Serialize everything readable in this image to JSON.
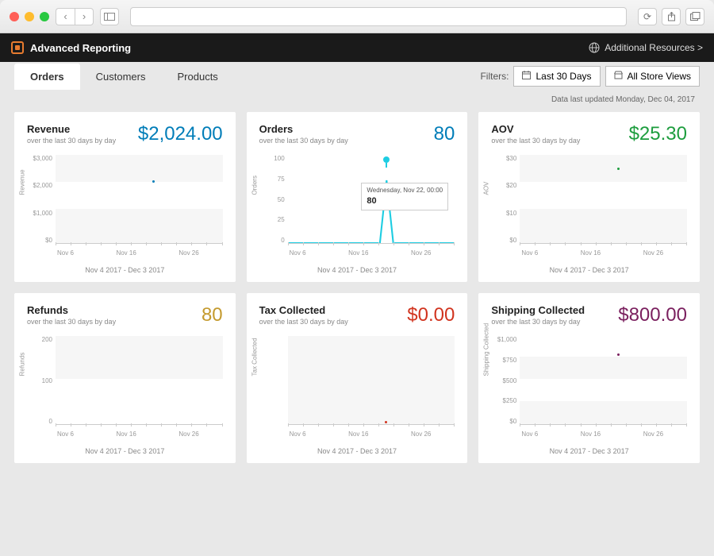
{
  "app": {
    "title": "Advanced Reporting",
    "resources": "Additional Resources >"
  },
  "tabs": {
    "orders": "Orders",
    "customers": "Customers",
    "products": "Products"
  },
  "filters": {
    "label": "Filters:",
    "period": "Last 30 Days",
    "scope": "All Store Views"
  },
  "updated": "Data last updated Monday, Dec 04, 2017",
  "common": {
    "subtitle": "over the last 30 days by day",
    "range": "Nov 4 2017 - Dec 3 2017",
    "xlabels": [
      "Nov 6",
      "",
      "Nov 16",
      "",
      "Nov 26",
      ""
    ]
  },
  "cards": {
    "revenue": {
      "title": "Revenue",
      "value": "$2,024.00",
      "yticks": [
        "$3,000",
        "$2,000",
        "$1,000",
        "$0"
      ],
      "axis": "Revenue"
    },
    "orders": {
      "title": "Orders",
      "value": "80",
      "yticks": [
        "100",
        "75",
        "50",
        "25",
        "0"
      ],
      "axis": "Orders",
      "tooltip_date": "Wednesday, Nov 22, 00:00",
      "tooltip_val": "80"
    },
    "aov": {
      "title": "AOV",
      "value": "$25.30",
      "yticks": [
        "$30",
        "$20",
        "$10",
        "$0"
      ],
      "axis": "AOV"
    },
    "refunds": {
      "title": "Refunds",
      "value": "80",
      "yticks": [
        "200",
        "100",
        "0"
      ],
      "axis": "Refunds"
    },
    "tax": {
      "title": "Tax Collected",
      "value": "$0.00",
      "yticks": [
        "",
        "",
        "",
        ""
      ],
      "axis": "Tax Collected"
    },
    "shipping": {
      "title": "Shipping Collected",
      "value": "$800.00",
      "yticks": [
        "$1,000",
        "$750",
        "$500",
        "$250",
        "$0"
      ],
      "axis": "Shipping Collected"
    }
  },
  "chart_data": [
    {
      "type": "line",
      "title": "Revenue",
      "ylabel": "Revenue",
      "ylim": [
        0,
        3000
      ],
      "x": [
        "Nov 4",
        "Nov 22",
        "Dec 3"
      ],
      "values": [
        0,
        2024,
        0
      ],
      "date_range": "Nov 4 2017 - Dec 3 2017"
    },
    {
      "type": "line",
      "title": "Orders",
      "ylabel": "Orders",
      "ylim": [
        0,
        100
      ],
      "x": [
        "Nov 4",
        "Nov 22",
        "Dec 3"
      ],
      "values": [
        0,
        80,
        0
      ],
      "date_range": "Nov 4 2017 - Dec 3 2017",
      "tooltip": {
        "label": "Wednesday, Nov 22, 00:00",
        "value": 80
      }
    },
    {
      "type": "line",
      "title": "AOV",
      "ylabel": "AOV",
      "ylim": [
        0,
        30
      ],
      "x": [
        "Nov 4",
        "Nov 22",
        "Dec 3"
      ],
      "values": [
        0,
        25.3,
        0
      ],
      "date_range": "Nov 4 2017 - Dec 3 2017"
    },
    {
      "type": "line",
      "title": "Refunds",
      "ylabel": "Refunds",
      "ylim": [
        0,
        200
      ],
      "x": [
        "Nov 4",
        "Dec 3"
      ],
      "values": [
        0,
        0
      ],
      "date_range": "Nov 4 2017 - Dec 3 2017"
    },
    {
      "type": "line",
      "title": "Tax Collected",
      "ylabel": "Tax Collected",
      "ylim": [
        0,
        1
      ],
      "x": [
        "Nov 4",
        "Nov 22",
        "Dec 3"
      ],
      "values": [
        0,
        0,
        0
      ],
      "date_range": "Nov 4 2017 - Dec 3 2017"
    },
    {
      "type": "line",
      "title": "Shipping Collected",
      "ylabel": "Shipping Collected",
      "ylim": [
        0,
        1000
      ],
      "x": [
        "Nov 4",
        "Nov 22",
        "Dec 3"
      ],
      "values": [
        0,
        800,
        0
      ],
      "date_range": "Nov 4 2017 - Dec 3 2017"
    }
  ]
}
